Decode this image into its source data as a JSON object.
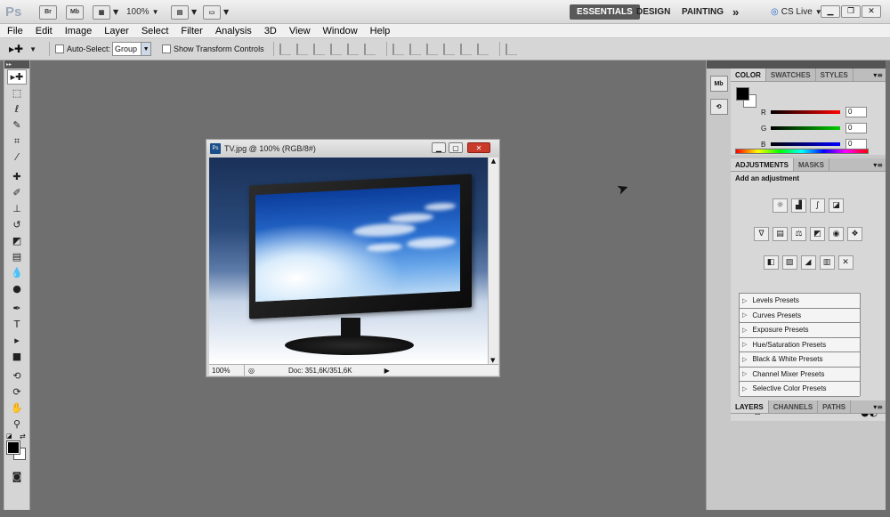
{
  "appbar": {
    "logo": "Ps",
    "bridge_icon": "Br",
    "minibridge_icon": "Mb",
    "zoom": "100%",
    "workspaces": [
      "ESSENTIALS",
      "DESIGN",
      "PAINTING"
    ],
    "more": "»",
    "cslive": "CS Live"
  },
  "menu": [
    "File",
    "Edit",
    "Image",
    "Layer",
    "Select",
    "Filter",
    "Analysis",
    "3D",
    "View",
    "Window",
    "Help"
  ],
  "options": {
    "auto_select_label": "Auto-Select:",
    "group_value": "Group",
    "show_transform_label": "Show Transform Controls"
  },
  "document": {
    "title": "TV.jpg @ 100% (RGB/8#)",
    "zoom": "100%",
    "doc_info": "Doc: 351,6K/351,6K"
  },
  "strip": {
    "mini_bridge": "Mb"
  },
  "color_panel": {
    "tabs": [
      "COLOR",
      "SWATCHES",
      "STYLES"
    ],
    "r_label": "R",
    "g_label": "G",
    "b_label": "B",
    "r_value": "0",
    "g_value": "0",
    "b_value": "0"
  },
  "adjustments_panel": {
    "tabs": [
      "ADJUSTMENTS",
      "MASKS"
    ],
    "title": "Add an adjustment",
    "presets": [
      "Levels Presets",
      "Curves Presets",
      "Exposure Presets",
      "Hue/Saturation Presets",
      "Black & White Presets",
      "Channel Mixer Presets",
      "Selective Color Presets"
    ]
  },
  "layers_panel": {
    "tabs": [
      "LAYERS",
      "CHANNELS",
      "PATHS"
    ]
  },
  "colors": {
    "accent": "#595959",
    "close": "#c93a2a"
  }
}
